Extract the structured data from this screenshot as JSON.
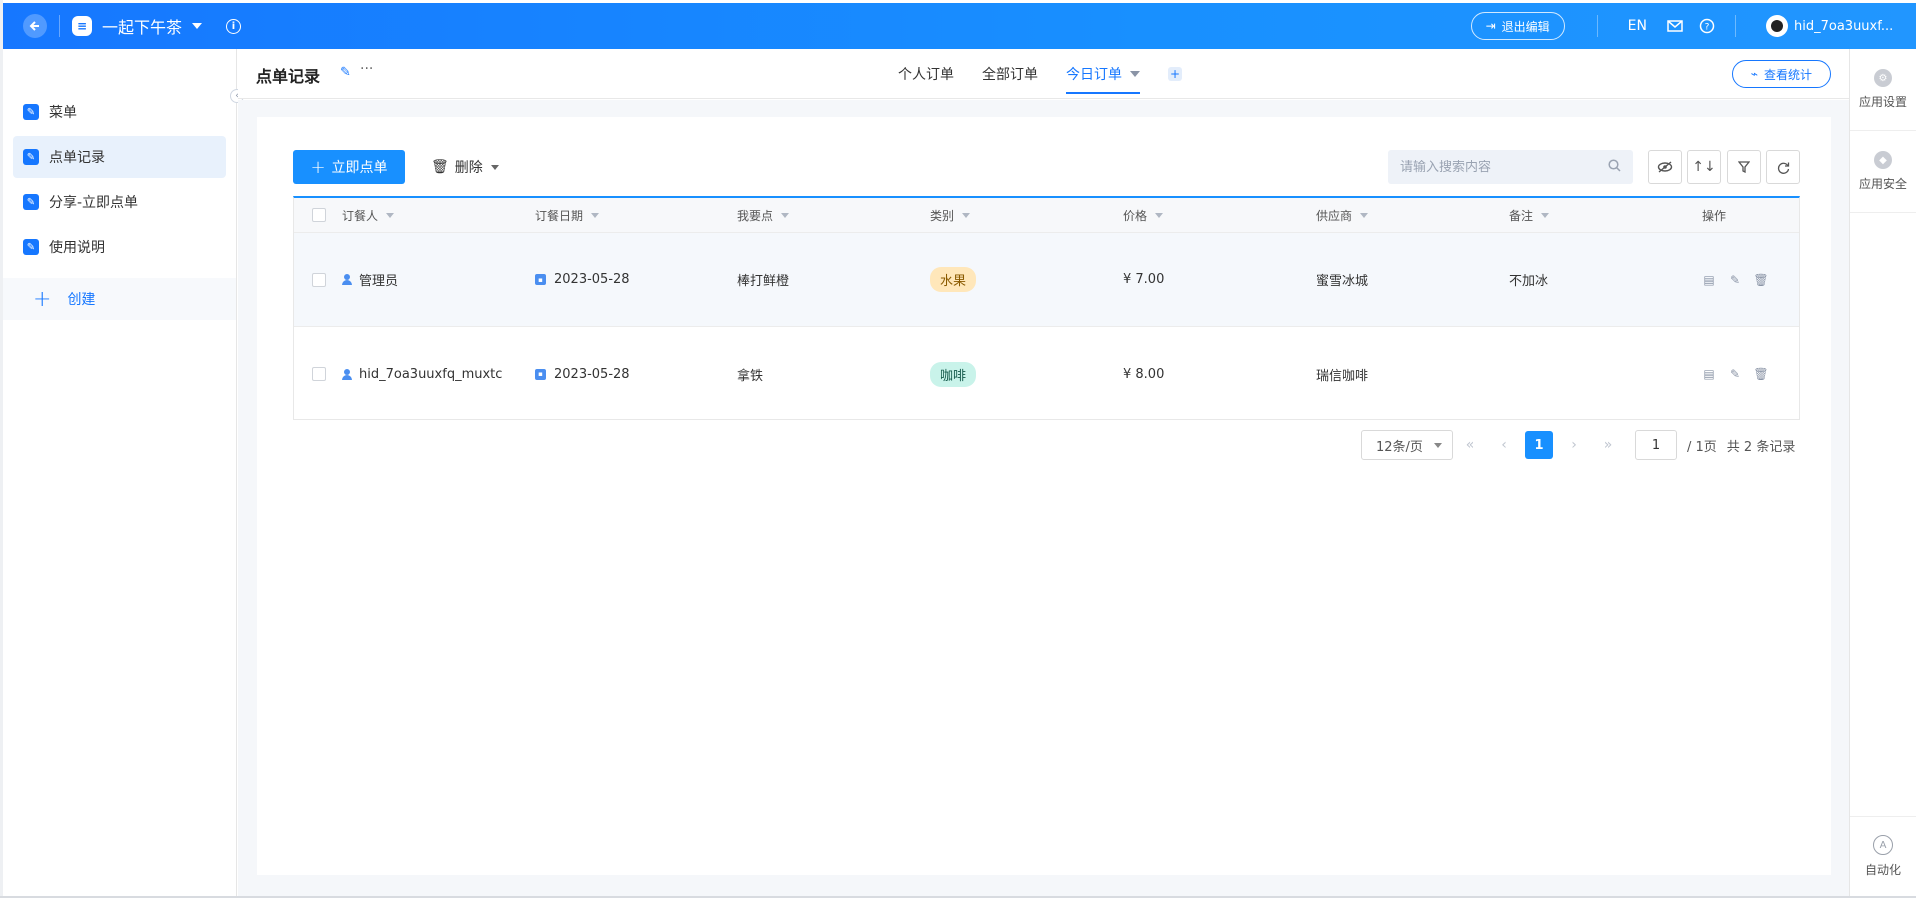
{
  "app": {
    "title": "一起下午茶",
    "icon": "app-doc-icon"
  },
  "topbar": {
    "exit_edit": "退出编辑",
    "lang": "EN",
    "user_name": "hid_7oa3uuxf..."
  },
  "sidebar": {
    "items": [
      {
        "label": "菜单",
        "icon": "form-icon"
      },
      {
        "label": "点单记录",
        "icon": "form-icon"
      },
      {
        "label": "分享-立即点单",
        "icon": "form-icon"
      },
      {
        "label": "使用说明",
        "icon": "form-icon"
      }
    ],
    "create_label": "创建",
    "active_index": 1
  },
  "page": {
    "title": "点单记录",
    "more": "···",
    "tabs": [
      {
        "label": "个人订单"
      },
      {
        "label": "全部订单"
      },
      {
        "label": "今日订单"
      }
    ],
    "stats_button": "查看统计"
  },
  "right_panel": {
    "app_settings": "应用设置",
    "app_security": "应用安全",
    "automation": "自动化"
  },
  "toolbar": {
    "order_now": "立即点单",
    "delete": "删除",
    "search_placeholder": "请输入搜索内容"
  },
  "table": {
    "columns": [
      "订餐人",
      "订餐日期",
      "我要点",
      "类别",
      "价格",
      "供应商",
      "备注",
      "操作"
    ],
    "rows": [
      {
        "name": "管理员",
        "date": "2023-05-28",
        "item": "棒打鲜橙",
        "category": "水果",
        "price": "¥ 7.00",
        "vendor": "蜜雪冰城",
        "note": "不加冰"
      },
      {
        "name": "hid_7oa3uuxfq_muxtc",
        "date": "2023-05-28",
        "item": "拿铁",
        "category": "咖啡",
        "price": "¥ 8.00",
        "vendor": "瑞信咖啡",
        "note": ""
      }
    ]
  },
  "pagination": {
    "page_size": "12条/页",
    "current_page": "1",
    "jump_value": "1",
    "total_pages": "/ 1页",
    "total_records": "共 2 条记录"
  },
  "colors": {
    "brand": "#1890ff",
    "tag_fruit": "#ffe7ba",
    "tag_coffee": "#c9f3ea"
  }
}
